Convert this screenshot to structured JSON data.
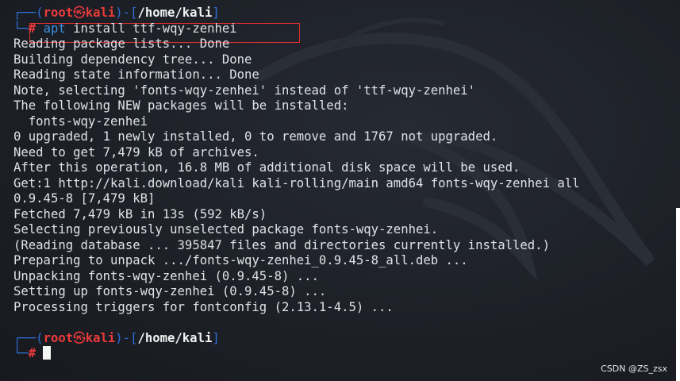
{
  "prompt": {
    "corner_top": "┌──(",
    "user": "root",
    "at_symbol": "㉿",
    "host": "kali",
    "close_paren": ")-[",
    "path": "/home/kali",
    "close_bracket": "]",
    "corner_bottom": "└─",
    "hash": "#"
  },
  "command": {
    "name": "apt",
    "args": " install ttf-wqy-zenhei"
  },
  "output_lines": [
    "Reading package lists... Done",
    "Building dependency tree... Done",
    "Reading state information... Done",
    "Note, selecting 'fonts-wqy-zenhei' instead of 'ttf-wqy-zenhei'",
    "The following NEW packages will be installed:",
    "  fonts-wqy-zenhei",
    "0 upgraded, 1 newly installed, 0 to remove and 1767 not upgraded.",
    "Need to get 7,479 kB of archives.",
    "After this operation, 16.8 MB of additional disk space will be used.",
    "Get:1 http://kali.download/kali kali-rolling/main amd64 fonts-wqy-zenhei all",
    "0.9.45-8 [7,479 kB]",
    "Fetched 7,479 kB in 13s (592 kB/s)",
    "Selecting previously unselected package fonts-wqy-zenhei.",
    "(Reading database ... 395847 files and directories currently installed.)",
    "Preparing to unpack .../fonts-wqy-zenhei_0.9.45-8_all.deb ...",
    "Unpacking fonts-wqy-zenhei (0.9.45-8) ...",
    "Setting up fonts-wqy-zenhei (0.9.45-8) ...",
    "Processing triggers for fontconfig (2.13.1-4.5) ..."
  ],
  "watermark": "CSDN @ZS_zsx",
  "colors": {
    "background": "#1d2027",
    "user": "#ea3b3b",
    "corner": "#2f6fd6",
    "command": "#3b8fe0",
    "text": "#dfe3e8",
    "highlight_box": "#d93030"
  }
}
